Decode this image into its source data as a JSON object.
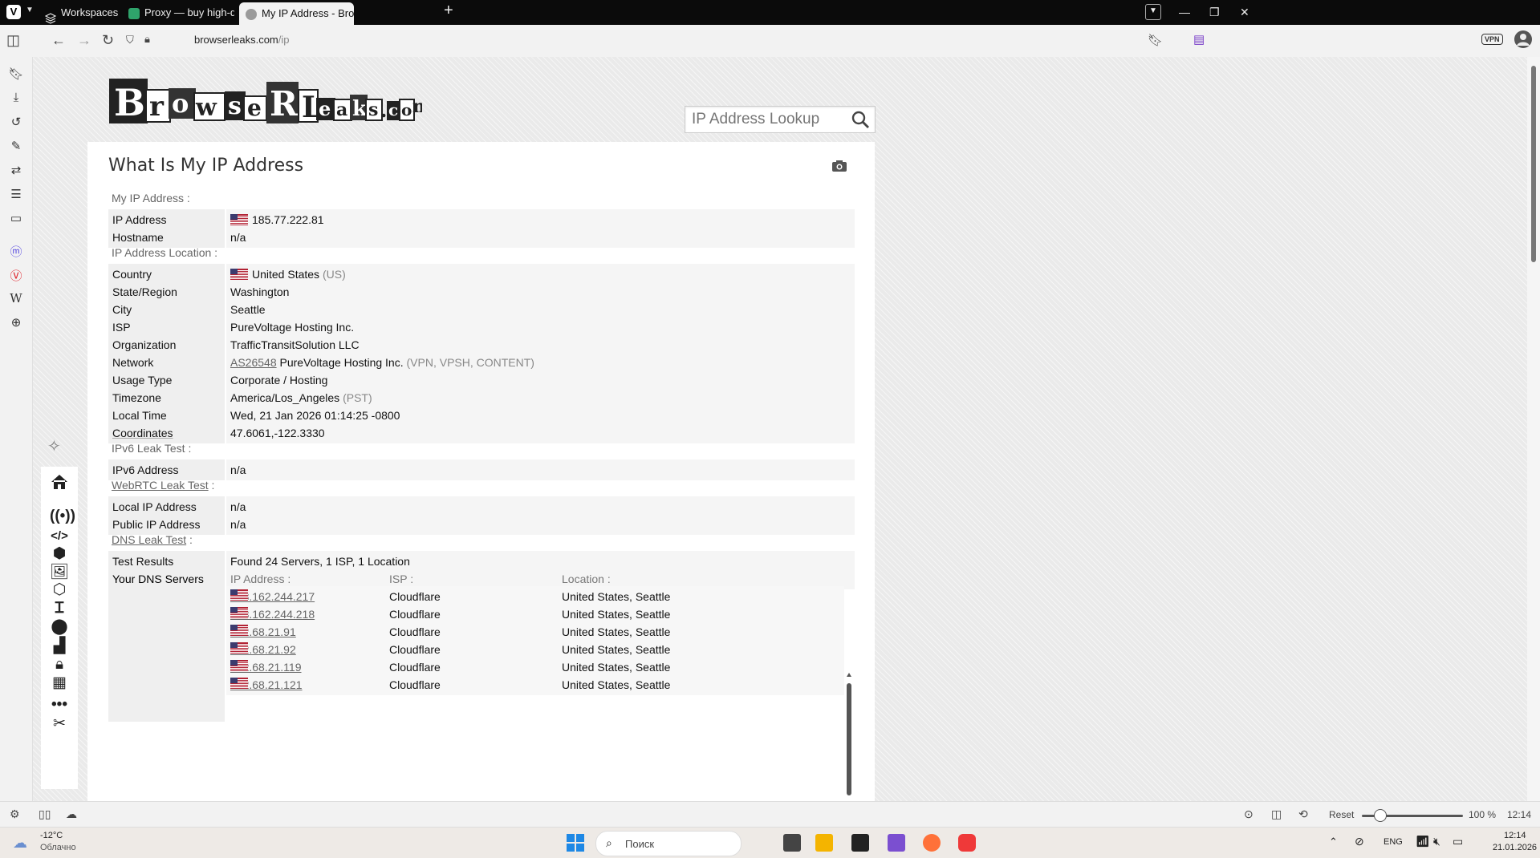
{
  "browser": {
    "tabs": [
      {
        "label": "Workspaces"
      },
      {
        "label": "Proxy — buy high-quality, r"
      },
      {
        "label": "My IP Address - BrowserLe"
      }
    ],
    "url_host": "browserleaks.com",
    "url_path": "/ip",
    "vpn_badge": "VPN"
  },
  "site": {
    "logo_text": "BrowserLeaks.com",
    "search_placeholder": "IP Address Lookup"
  },
  "content": {
    "title": "What Is My IP Address",
    "sections": {
      "my_ip": "My IP Address :",
      "location": "IP Address Location :",
      "ipv6": "IPv6 Leak Test :",
      "webrtc": "WebRTC Leak Test",
      "dns": "DNS Leak Test",
      "colon": ":"
    },
    "ip": {
      "ip_label": "IP Address",
      "ip_value": "185.77.222.81",
      "host_label": "Hostname",
      "host_value": "n/a"
    },
    "location": {
      "country_label": "Country",
      "country_value": "United States",
      "country_code": "(US)",
      "region_label": "State/Region",
      "region_value": "Washington",
      "city_label": "City",
      "city_value": "Seattle",
      "isp_label": "ISP",
      "isp_value": "PureVoltage Hosting Inc.",
      "org_label": "Organization",
      "org_value": "TrafficTransitSolution LLC",
      "net_label": "Network",
      "net_asn": "AS26548",
      "net_value": "PureVoltage Hosting Inc.",
      "net_tags": "(VPN, VPSH, CONTENT)",
      "usage_label": "Usage Type",
      "usage_value": "Corporate / Hosting",
      "tz_label": "Timezone",
      "tz_value": "America/Los_Angeles",
      "tz_abbr": "(PST)",
      "time_label": "Local Time",
      "time_value": "Wed, 21 Jan 2026 01:14:25 -0800",
      "coord_label": "Coordinates",
      "coord_value": "47.6061,-122.3330"
    },
    "ipv6": {
      "label": "IPv6 Address",
      "value": "n/a"
    },
    "webrtc": {
      "local_label": "Local IP Address",
      "local_value": "n/a",
      "public_label": "Public IP Address",
      "public_value": "n/a"
    },
    "dns": {
      "results_label": "Test Results",
      "results_value": "Found 24 Servers, 1 ISP, 1 Location",
      "servers_label": "Your DNS Servers",
      "col_ip": "IP Address :",
      "col_isp": "ISP :",
      "col_loc": "Location :",
      "rows": [
        {
          "ip": "108.162.244.217",
          "isp": "Cloudflare",
          "loc": "United States, Seattle"
        },
        {
          "ip": "108.162.244.218",
          "isp": "Cloudflare",
          "loc": "United States, Seattle"
        },
        {
          "ip": "172.68.21.91",
          "isp": "Cloudflare",
          "loc": "United States, Seattle"
        },
        {
          "ip": "172.68.21.92",
          "isp": "Cloudflare",
          "loc": "United States, Seattle"
        },
        {
          "ip": "172.68.21.119",
          "isp": "Cloudflare",
          "loc": "United States, Seattle"
        },
        {
          "ip": "172.68.21.121",
          "isp": "Cloudflare",
          "loc": "United States, Seattle"
        }
      ]
    }
  },
  "statusbar": {
    "reset": "Reset",
    "zoom": "100 %",
    "clock": "12:14"
  },
  "taskbar": {
    "weather_temp": "-12°C",
    "weather_desc": "Облачно",
    "search": "Поиск",
    "lang": "ENG",
    "time": "12:14",
    "date": "21.01.2026"
  }
}
